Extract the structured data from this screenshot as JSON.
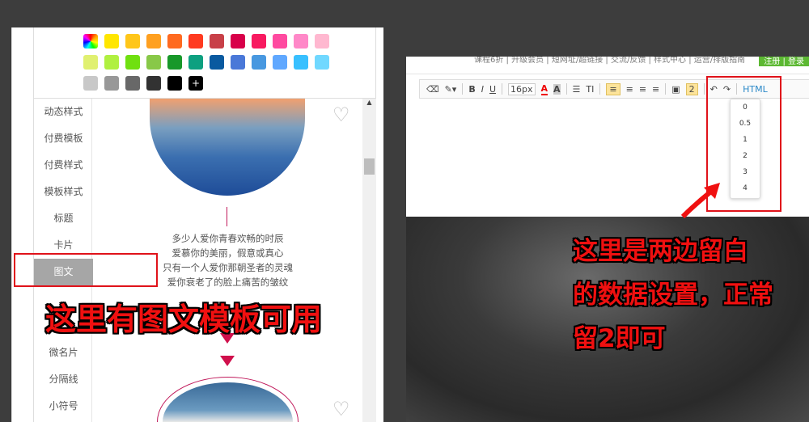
{
  "palette": {
    "colors": [
      "rainbow",
      "#ffe600",
      "#ffc61a",
      "#ffa020",
      "#ff6a20",
      "#ff3a20",
      "#c84048",
      "#d8004a",
      "#f81a60",
      "#ff4aa0",
      "#ff88c8",
      "#ffb8d0",
      "#e0f070",
      "#b0f040",
      "#70e010",
      "#88c848",
      "#18982a",
      "#0ea080",
      "#0a5aa0",
      "#4a78d8",
      "#4898e0",
      "#60a8ff",
      "#38c0ff",
      "#70d8ff",
      "#c8c8c8",
      "#989898",
      "#686868",
      "#323232",
      "#000000"
    ],
    "add_label": "+"
  },
  "sidebar": {
    "items": [
      {
        "label": "动态样式"
      },
      {
        "label": "付费模板"
      },
      {
        "label": "付费样式"
      },
      {
        "label": "模板样式"
      },
      {
        "label": "标题"
      },
      {
        "label": "卡片"
      },
      {
        "label": "图文",
        "active": true
      },
      {
        "label": "微名片"
      },
      {
        "label": "分隔线"
      },
      {
        "label": "小符号"
      }
    ]
  },
  "template": {
    "poem": [
      "多少人爱你青春欢畅的时辰",
      "爱慕你的美丽，假意或真心",
      "只有一个人爱你那朝圣者的灵魂",
      "爱你衰老了的脸上痛苦的皱纹"
    ]
  },
  "annotations": {
    "left": "这里有图文模板可用",
    "right": [
      "这里是两边留白",
      "的数据设置，正常",
      "留2即可"
    ]
  },
  "topnav": {
    "items": [
      "课程6折",
      "升级会员",
      "短网址/超链接",
      "交流/反馈",
      "样式中心",
      "运营/排版指南"
    ],
    "register": "注册 | 登录"
  },
  "toolbar": {
    "bold": "B",
    "italic": "I",
    "underline": "U",
    "font_size": "16px",
    "font_color": "A",
    "bg_color": "A",
    "list": "☰",
    "title": "TI",
    "padding_value": "2",
    "html": "HTML"
  },
  "padding_dropdown": {
    "options": [
      "0",
      "0.5",
      "1",
      "2",
      "3",
      "4"
    ]
  },
  "accent": "#e0121a"
}
